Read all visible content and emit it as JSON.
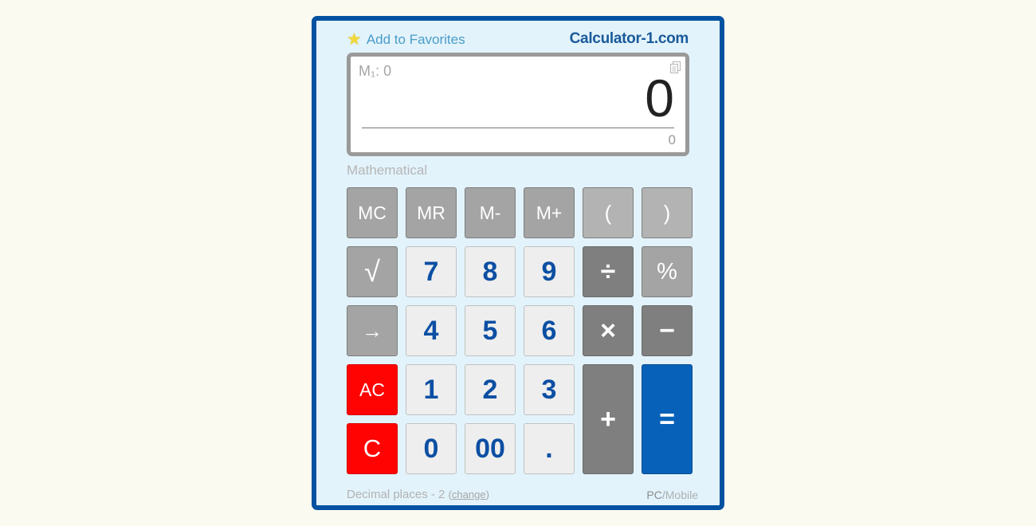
{
  "header": {
    "favorites_label": "Add to Favorites",
    "brand": "Calculator-1.com"
  },
  "display": {
    "memory": "M₁: 0",
    "value": "0",
    "sub_value": "0"
  },
  "mode_label": "Mathematical",
  "keys": {
    "mc": "MC",
    "mr": "MR",
    "m_minus": "M-",
    "m_plus": "M+",
    "paren_open": "(",
    "paren_close": ")",
    "sqrt": "√",
    "seven": "7",
    "eight": "8",
    "nine": "9",
    "divide": "÷",
    "percent": "%",
    "backspace": "→",
    "four": "4",
    "five": "5",
    "six": "6",
    "multiply": "×",
    "minus": "−",
    "ac": "AC",
    "one": "1",
    "two": "2",
    "three": "3",
    "plus": "+",
    "equals": "=",
    "clear": "C",
    "zero": "0",
    "double_zero": "00",
    "decimal": "."
  },
  "footer": {
    "decimal_text": "Decimal places - 2",
    "paren_open": "(",
    "change_label": "change",
    "paren_close": ")",
    "pc_label": "PC",
    "separator": "/",
    "mobile_label": "Mobile"
  },
  "colors": {
    "frame": "#0352a1",
    "panel": "#e2f3fb",
    "digit_text": "#0c4fa3",
    "clear_red": "#ff0303",
    "equals_blue": "#0861b8"
  },
  "icons": {
    "favorites": "star-icon",
    "copy": "copy-icon"
  }
}
